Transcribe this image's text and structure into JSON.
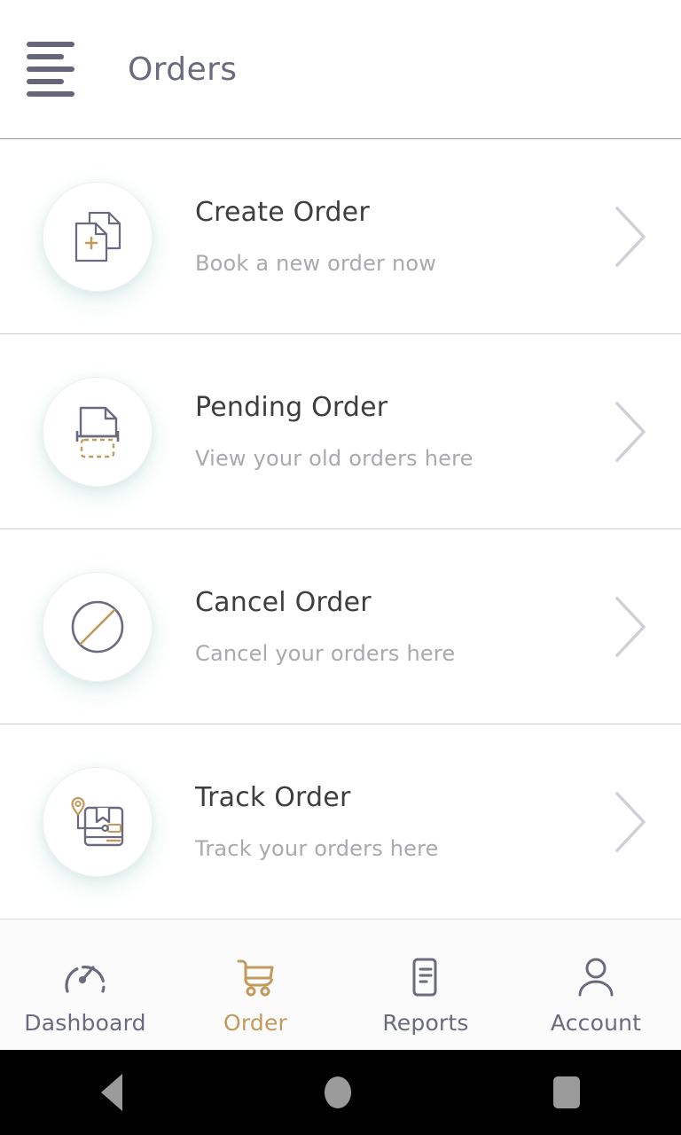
{
  "header": {
    "menu_icon": "hamburger-menu-icon",
    "title": "Orders"
  },
  "colors": {
    "accent_gold": "#c39a5d",
    "icon_purple": "#6b6b80",
    "title_text": "#3e3e3e",
    "subtitle_text": "#a9a9ae",
    "chevron": "#cfcfd8",
    "divider": "#c9c9d0",
    "nav_bg": "#fbfbfb",
    "system_bar": "#000000"
  },
  "list": {
    "items": [
      {
        "title": "Create Order",
        "subtitle": "Book a new order now",
        "icon": "documents-plus-icon",
        "chevron": "chevron-right-icon"
      },
      {
        "title": "Pending Order",
        "subtitle": "View your old orders here",
        "icon": "document-pending-dashed-icon",
        "chevron": "chevron-right-icon"
      },
      {
        "title": "Cancel Order",
        "subtitle": "Cancel your orders here",
        "icon": "circle-slash-cancel-icon",
        "chevron": "chevron-right-icon"
      },
      {
        "title": "Track Order",
        "subtitle": "Track your orders here",
        "icon": "package-location-track-icon",
        "chevron": "chevron-right-icon"
      }
    ]
  },
  "bottom_nav": {
    "items": [
      {
        "label": "Dashboard",
        "icon": "speedometer-gauge-icon",
        "active": false
      },
      {
        "label": "Order",
        "icon": "shopping-cart-icon",
        "active": true
      },
      {
        "label": "Reports",
        "icon": "report-document-icon",
        "active": false
      },
      {
        "label": "Account",
        "icon": "user-person-icon",
        "active": false
      }
    ]
  },
  "system_nav": {
    "back": "android-back-icon",
    "home": "android-home-icon",
    "recents": "android-recents-icon"
  }
}
